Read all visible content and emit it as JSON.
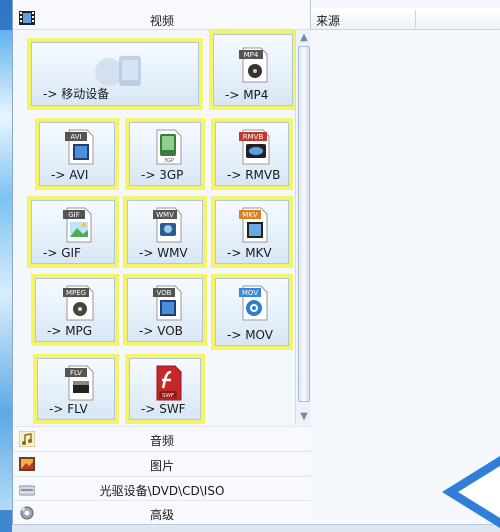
{
  "left_panel": {
    "video_category": "视频",
    "formats": [
      {
        "id": "mobile",
        "label": "-> 移动设备",
        "badge": ""
      },
      {
        "id": "mp4",
        "label": "-> MP4",
        "badge": "MP4"
      },
      {
        "id": "avi",
        "label": "-> AVI",
        "badge": "AVI"
      },
      {
        "id": "3gp",
        "label": "-> 3GP",
        "badge": "3GP"
      },
      {
        "id": "rmvb",
        "label": "-> RMVB",
        "badge": "RMVB"
      },
      {
        "id": "gif",
        "label": "-> GIF",
        "badge": "GIF"
      },
      {
        "id": "wmv",
        "label": "-> WMV",
        "badge": "WMV"
      },
      {
        "id": "mkv",
        "label": "-> MKV",
        "badge": "MKV"
      },
      {
        "id": "mpg",
        "label": "-> MPG",
        "badge": "MPEG"
      },
      {
        "id": "vob",
        "label": "-> VOB",
        "badge": "VOB"
      },
      {
        "id": "mov",
        "label": "-> MOV",
        "badge": "MOV"
      },
      {
        "id": "flv",
        "label": "-> FLV",
        "badge": "FLV"
      },
      {
        "id": "swf",
        "label": "-> SWF",
        "badge": "SWF"
      }
    ],
    "categories": [
      {
        "id": "audio",
        "label": "音频",
        "icon": "music-note-icon"
      },
      {
        "id": "picture",
        "label": "图片",
        "icon": "picture-icon"
      },
      {
        "id": "disc",
        "label": "光驱设备\\DVD\\CD\\ISO",
        "icon": "disc-drive-icon"
      },
      {
        "id": "advanced",
        "label": "高级",
        "icon": "gear-icon"
      }
    ]
  },
  "right_panel": {
    "column_header": "来源"
  },
  "colors": {
    "highlight": "#f4f46a",
    "accent": "#3f86d2"
  }
}
